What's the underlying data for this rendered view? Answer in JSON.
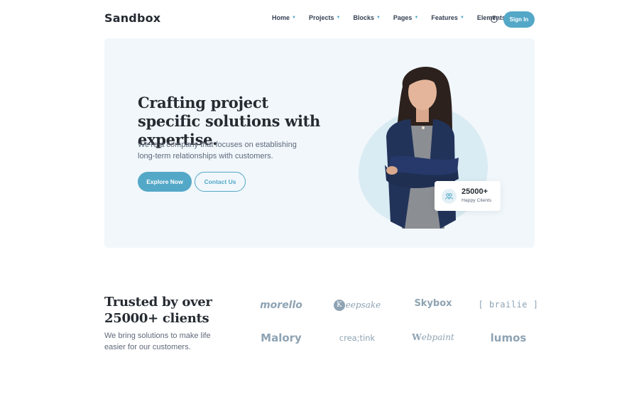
{
  "brand": {
    "logo": "Sandbox",
    "accent": "#54a8c7"
  },
  "nav": {
    "items": [
      {
        "label": "Home"
      },
      {
        "label": "Projects"
      },
      {
        "label": "Blocks"
      },
      {
        "label": "Pages"
      },
      {
        "label": "Features"
      },
      {
        "label": "Elements"
      }
    ],
    "info_icon": "info-icon",
    "signin_label": "Sign In"
  },
  "hero": {
    "title": "Crafting project specific solutions with expertise.",
    "subtitle": "We're a company that focuses on establishing long-term relationships with customers.",
    "primary_button": "Explore Now",
    "secondary_button": "Contact Us",
    "stat": {
      "icon": "users-icon",
      "value": "25000+",
      "label": "Happy Clients"
    }
  },
  "trusted": {
    "title": "Trusted by over 25000+ clients",
    "subtitle": "We bring solutions to make life easier for our customers.",
    "logos": [
      "morello",
      "eepsake",
      "Skybox",
      "[ brailie ]",
      "Malory",
      "crea;tink",
      "ebpaint",
      "lumos"
    ]
  }
}
